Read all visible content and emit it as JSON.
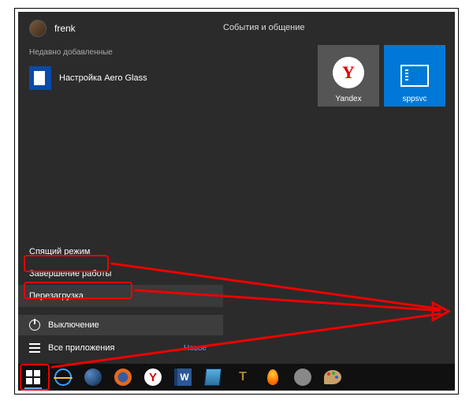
{
  "user": {
    "name": "frenk"
  },
  "recent": {
    "heading": "Недавно добавленные",
    "items": [
      {
        "label": "Настройка Aero Glass",
        "icon": "document-icon"
      }
    ]
  },
  "tiles": {
    "heading": "События и общение",
    "items": [
      {
        "label": "Yandex",
        "icon": "yandex-icon",
        "style": "gray"
      },
      {
        "label": "sppsvc",
        "icon": "sppsvc-icon",
        "style": "blue"
      }
    ]
  },
  "power_menu": {
    "items": [
      {
        "label": "Спящий режим"
      },
      {
        "label": "Завершение работы"
      },
      {
        "label": "Перезагрузка"
      }
    ]
  },
  "footer": {
    "power_label": "Выключение",
    "all_apps_label": "Все приложения",
    "new_label": "Новое"
  },
  "taskbar": {
    "items": [
      {
        "name": "start-button",
        "icon": "windows-start-icon"
      },
      {
        "name": "ie-button",
        "icon": "ie-icon"
      },
      {
        "name": "browser-button",
        "icon": "globe-icon"
      },
      {
        "name": "firefox-button",
        "icon": "firefox-icon"
      },
      {
        "name": "yandex-button",
        "icon": "yandex-icon",
        "glyph": "Y"
      },
      {
        "name": "word-button",
        "icon": "word-icon",
        "glyph": "W"
      },
      {
        "name": "reader-button",
        "icon": "book-icon"
      },
      {
        "name": "tool-button",
        "icon": "tr-icon",
        "glyph": "T"
      },
      {
        "name": "burn-button",
        "icon": "flame-icon"
      },
      {
        "name": "app-button",
        "icon": "generic-icon"
      },
      {
        "name": "paint-button",
        "icon": "palette-icon"
      }
    ]
  },
  "annotations": {
    "highlights": [
      "restart-option",
      "shutdown-option",
      "start-button"
    ],
    "arrow_color": "#e00000"
  }
}
